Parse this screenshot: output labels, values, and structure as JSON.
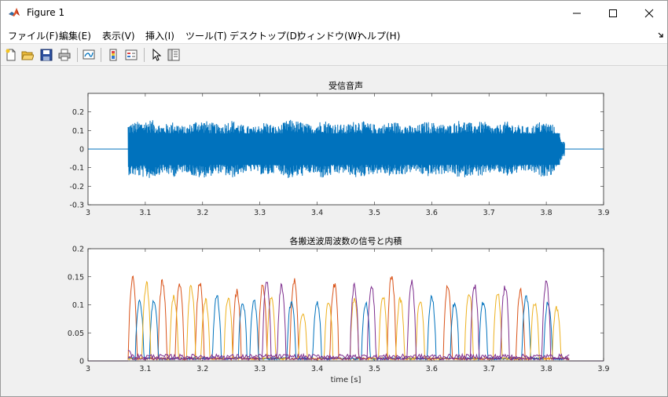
{
  "window": {
    "title": "Figure 1"
  },
  "menu": [
    "ファイル(F)",
    "編集(E)",
    "表示(V)",
    "挿入(I)",
    "ツール(T)",
    "デスクトップ(D)",
    "ウィンドウ(W)",
    "ヘルプ(H)"
  ],
  "toolbar_icons": [
    "new-figure-icon",
    "open-file-icon",
    "save-icon",
    "print-icon",
    "link-plot-icon",
    "colorbar-icon",
    "legend-icon",
    "select-arrow-icon",
    "property-inspector-icon"
  ],
  "colors": {
    "blue": "#0072BD",
    "orange": "#D95319",
    "yellow": "#EDB120",
    "purple": "#7E2F8E"
  },
  "chart_data": [
    {
      "type": "line",
      "title": "受信音声",
      "xlabel": "",
      "ylabel": "",
      "xlim": [
        3,
        3.9
      ],
      "ylim": [
        -0.3,
        0.3
      ],
      "xticks": [
        "3",
        "3.1",
        "3.2",
        "3.3",
        "3.4",
        "3.5",
        "3.6",
        "3.7",
        "3.8",
        "3.9"
      ],
      "yticks": [
        "-0.3",
        "-0.2",
        "-0.1",
        "0",
        "0.1",
        "0.2"
      ],
      "signal_start": 3.07,
      "signal_end": 3.832,
      "envelope_t": [
        3.07,
        3.09,
        3.11,
        3.13,
        3.15,
        3.17,
        3.19,
        3.21,
        3.23,
        3.25,
        3.27,
        3.29,
        3.31,
        3.33,
        3.35,
        3.37,
        3.39,
        3.41,
        3.43,
        3.45,
        3.47,
        3.49,
        3.51,
        3.53,
        3.55,
        3.57,
        3.59,
        3.61,
        3.63,
        3.65,
        3.67,
        3.69,
        3.71,
        3.73,
        3.75,
        3.77,
        3.79,
        3.81,
        3.83
      ],
      "envelope_amp": [
        0.14,
        0.15,
        0.16,
        0.13,
        0.15,
        0.12,
        0.16,
        0.15,
        0.13,
        0.16,
        0.13,
        0.12,
        0.15,
        0.12,
        0.16,
        0.15,
        0.13,
        0.16,
        0.14,
        0.13,
        0.16,
        0.14,
        0.13,
        0.15,
        0.14,
        0.12,
        0.15,
        0.14,
        0.13,
        0.16,
        0.14,
        0.15,
        0.12,
        0.15,
        0.13,
        0.12,
        0.15,
        0.14,
        0.04
      ]
    },
    {
      "type": "line",
      "title": "各搬送波周波数の信号と内積",
      "xlabel": "time [s]",
      "ylabel": "",
      "xlim": [
        3,
        3.9
      ],
      "ylim": [
        0,
        0.2
      ],
      "xticks": [
        "3",
        "3.1",
        "3.2",
        "3.3",
        "3.4",
        "3.5",
        "3.6",
        "3.7",
        "3.8",
        "3.9"
      ],
      "yticks": [
        "0",
        "0.05",
        "0.1",
        "0.15",
        "0.2"
      ],
      "series": [
        {
          "color": "#D95319",
          "peaks": [
            [
              3.078,
              0.153
            ],
            [
              3.13,
              0.15
            ],
            [
              3.16,
              0.145
            ],
            [
              3.195,
              0.145
            ],
            [
              3.26,
              0.13
            ],
            [
              3.305,
              0.14
            ],
            [
              3.36,
              0.15
            ],
            [
              3.43,
              0.145
            ],
            [
              3.53,
              0.161
            ],
            [
              3.628,
              0.14
            ],
            [
              3.755,
              0.13
            ]
          ]
        },
        {
          "color": "#0072BD",
          "peaks": [
            [
              3.09,
              0.11
            ],
            [
              3.115,
              0.115
            ],
            [
              3.225,
              0.12
            ],
            [
              3.27,
              0.11
            ],
            [
              3.29,
              0.11
            ],
            [
              3.355,
              0.11
            ],
            [
              3.4,
              0.11
            ],
            [
              3.485,
              0.11
            ],
            [
              3.6,
              0.12
            ],
            [
              3.64,
              0.11
            ],
            [
              3.69,
              0.11
            ],
            [
              3.765,
              0.12
            ],
            [
              3.803,
              0.11
            ]
          ]
        },
        {
          "color": "#EDB120",
          "peaks": [
            [
              3.102,
              0.145
            ],
            [
              3.15,
              0.12
            ],
            [
              3.18,
              0.14
            ],
            [
              3.205,
              0.115
            ],
            [
              3.245,
              0.12
            ],
            [
              3.32,
              0.12
            ],
            [
              3.375,
              0.09
            ],
            [
              3.42,
              0.11
            ],
            [
              3.465,
              0.115
            ],
            [
              3.515,
              0.12
            ],
            [
              3.545,
              0.115
            ],
            [
              3.58,
              0.115
            ],
            [
              3.665,
              0.13
            ],
            [
              3.715,
              0.13
            ],
            [
              3.78,
              0.11
            ],
            [
              3.818,
              0.1
            ]
          ]
        },
        {
          "color": "#7E2F8E",
          "peaks": [
            [
              3.07,
              0.02
            ],
            [
              3.312,
              0.15
            ],
            [
              3.338,
              0.14
            ],
            [
              3.465,
              0.14
            ],
            [
              3.495,
              0.14
            ],
            [
              3.565,
              0.148
            ],
            [
              3.675,
              0.14
            ],
            [
              3.728,
              0.14
            ],
            [
              3.8,
              0.15
            ]
          ]
        }
      ]
    }
  ]
}
